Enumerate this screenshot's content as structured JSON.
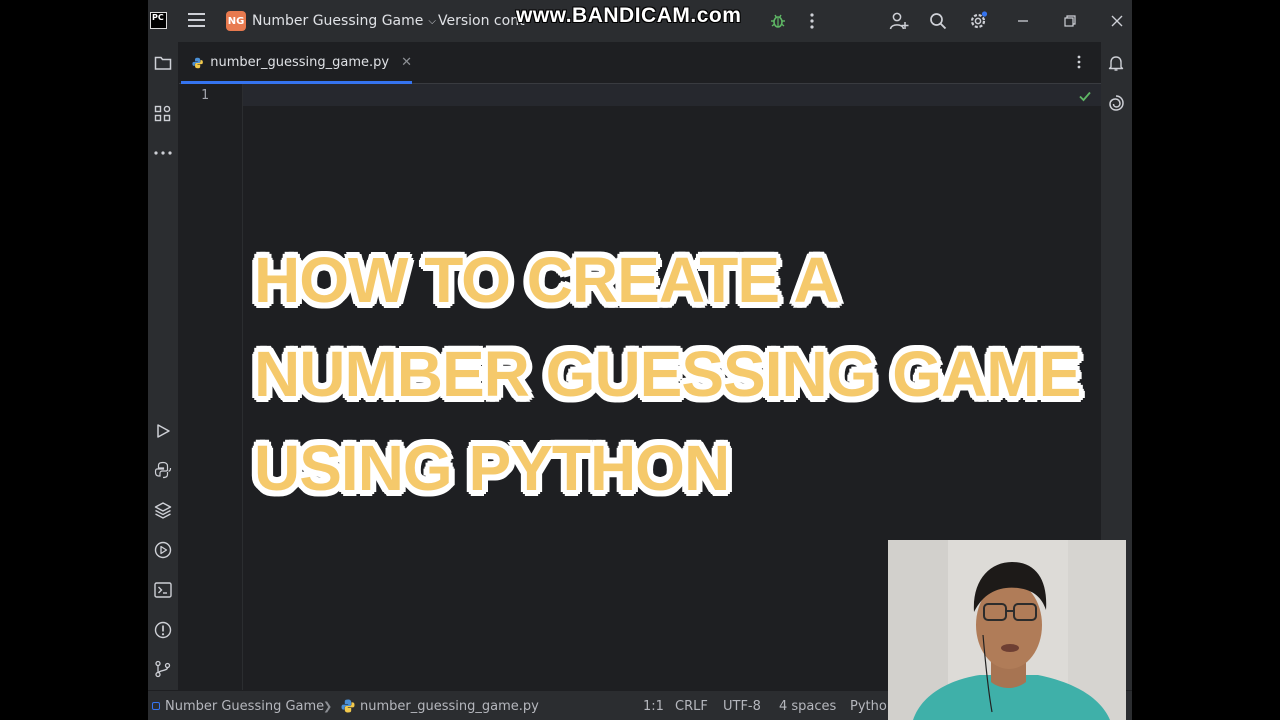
{
  "titlebar": {
    "logo": "PC",
    "project_badge": "NG",
    "project_name": "Number Guessing Game",
    "vcs_label": "Version cont",
    "watermark": "www.BANDICAM.com",
    "icons": [
      "menu-icon",
      "bug-icon",
      "more-vertical-icon",
      "add-user-icon",
      "search-icon",
      "gear-icon",
      "minimize-icon",
      "restore-icon",
      "close-icon"
    ]
  },
  "tabs": [
    {
      "label": "number_guessing_game.py",
      "icon": "python-icon",
      "active": true
    }
  ],
  "editor": {
    "line_numbers": [
      "1"
    ],
    "accent": "#3574f0",
    "background": "#1e1f22"
  },
  "overlay": {
    "line1": "HOW TO CREATE A",
    "line2": "NUMBER GUESSING GAME",
    "line3": "USING PYTHON",
    "text_color": "#f5c96b",
    "outline_color": "#ffffff"
  },
  "statusbar": {
    "project": "Number Guessing Game",
    "file": "number_guessing_game.py",
    "position": "1:1",
    "line_ending": "CRLF",
    "encoding": "UTF-8",
    "indent": "4 spaces",
    "interpreter": "Pytho"
  }
}
